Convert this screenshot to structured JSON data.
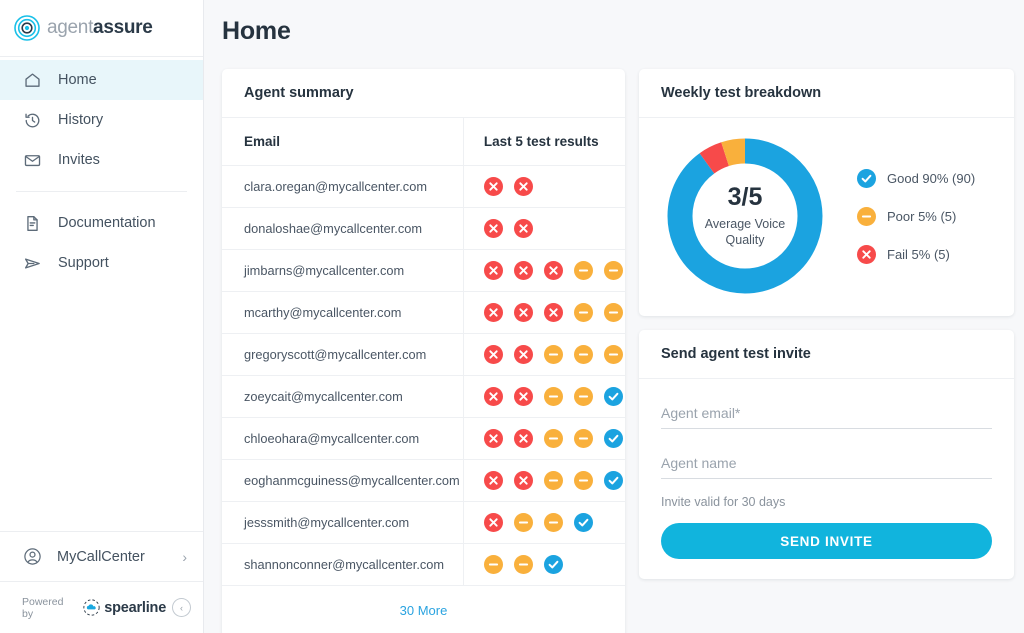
{
  "brand": {
    "logo_icon": "signal-waves-icon",
    "name_light": "agent",
    "name_bold": "assure"
  },
  "sidebar": {
    "items": [
      {
        "label": "Home",
        "icon": "home-icon",
        "active": true
      },
      {
        "label": "History",
        "icon": "history-icon",
        "active": false
      },
      {
        "label": "Invites",
        "icon": "mail-icon",
        "active": false
      },
      {
        "label": "Documentation",
        "icon": "document-icon",
        "active": false
      },
      {
        "label": "Support",
        "icon": "send-icon",
        "active": false
      }
    ],
    "account": {
      "label": "MyCallCenter",
      "icon": "user-avatar-icon",
      "chevron": "›"
    },
    "footer": {
      "powered_by": "Powered by",
      "partner": "spearline",
      "collapse_icon": "‹"
    }
  },
  "header": {
    "title": "Home"
  },
  "agent_summary": {
    "title": "Agent summary",
    "columns": [
      "Email",
      "Last 5 test results"
    ],
    "rows": [
      {
        "email": "clara.oregan@mycallcenter.com",
        "results": [
          "fail",
          "fail"
        ]
      },
      {
        "email": "donaloshae@mycallcenter.com",
        "results": [
          "fail",
          "fail"
        ]
      },
      {
        "email": "jimbarns@mycallcenter.com",
        "results": [
          "fail",
          "fail",
          "fail",
          "poor",
          "poor"
        ]
      },
      {
        "email": "mcarthy@mycallcenter.com",
        "results": [
          "fail",
          "fail",
          "fail",
          "poor",
          "poor"
        ]
      },
      {
        "email": "gregoryscott@mycallcenter.com",
        "results": [
          "fail",
          "fail",
          "poor",
          "poor",
          "poor"
        ]
      },
      {
        "email": "zoeycait@mycallcenter.com",
        "results": [
          "fail",
          "fail",
          "poor",
          "poor",
          "good"
        ]
      },
      {
        "email": "chloeohara@mycallcenter.com",
        "results": [
          "fail",
          "fail",
          "poor",
          "poor",
          "good"
        ]
      },
      {
        "email": "eoghanmcguiness@mycallcenter.com",
        "results": [
          "fail",
          "fail",
          "poor",
          "poor",
          "good"
        ]
      },
      {
        "email": "jesssmith@mycallcenter.com",
        "results": [
          "fail",
          "poor",
          "poor",
          "good"
        ]
      },
      {
        "email": "shannonconner@mycallcenter.com",
        "results": [
          "poor",
          "poor",
          "good"
        ]
      }
    ],
    "more_label": "30 More"
  },
  "weekly": {
    "title": "Weekly test breakdown"
  },
  "chart_data": {
    "type": "pie",
    "title": "Weekly test breakdown",
    "center_value": "3/5",
    "center_label": "Average Voice Quality",
    "categories": [
      "Good",
      "Poor",
      "Fail"
    ],
    "values": [
      90,
      5,
      5
    ],
    "counts": [
      90,
      5,
      5
    ],
    "legend": [
      {
        "label": "Good 90% (90)",
        "color": "#1ba3e0",
        "icon": "check-circle-icon"
      },
      {
        "label": "Poor 5% (5)",
        "color": "#f9b03c",
        "icon": "minus-circle-icon"
      },
      {
        "label": "Fail 5% (5)",
        "color": "#f74a4a",
        "icon": "x-circle-icon"
      }
    ],
    "legend_position": "right",
    "donut": true
  },
  "invite": {
    "title": "Send agent test invite",
    "email_placeholder": "Agent email*",
    "email_value": "",
    "name_placeholder": "Agent name",
    "name_value": "",
    "hint": "Invite valid for 30 days",
    "submit_label": "SEND INVITE"
  },
  "colors": {
    "accent": "#11b4dd",
    "good": "#1ba3e0",
    "poor": "#f9b03c",
    "fail": "#f74a4a",
    "link": "#2aa3e0",
    "page_bg": "#f7f8fa"
  }
}
